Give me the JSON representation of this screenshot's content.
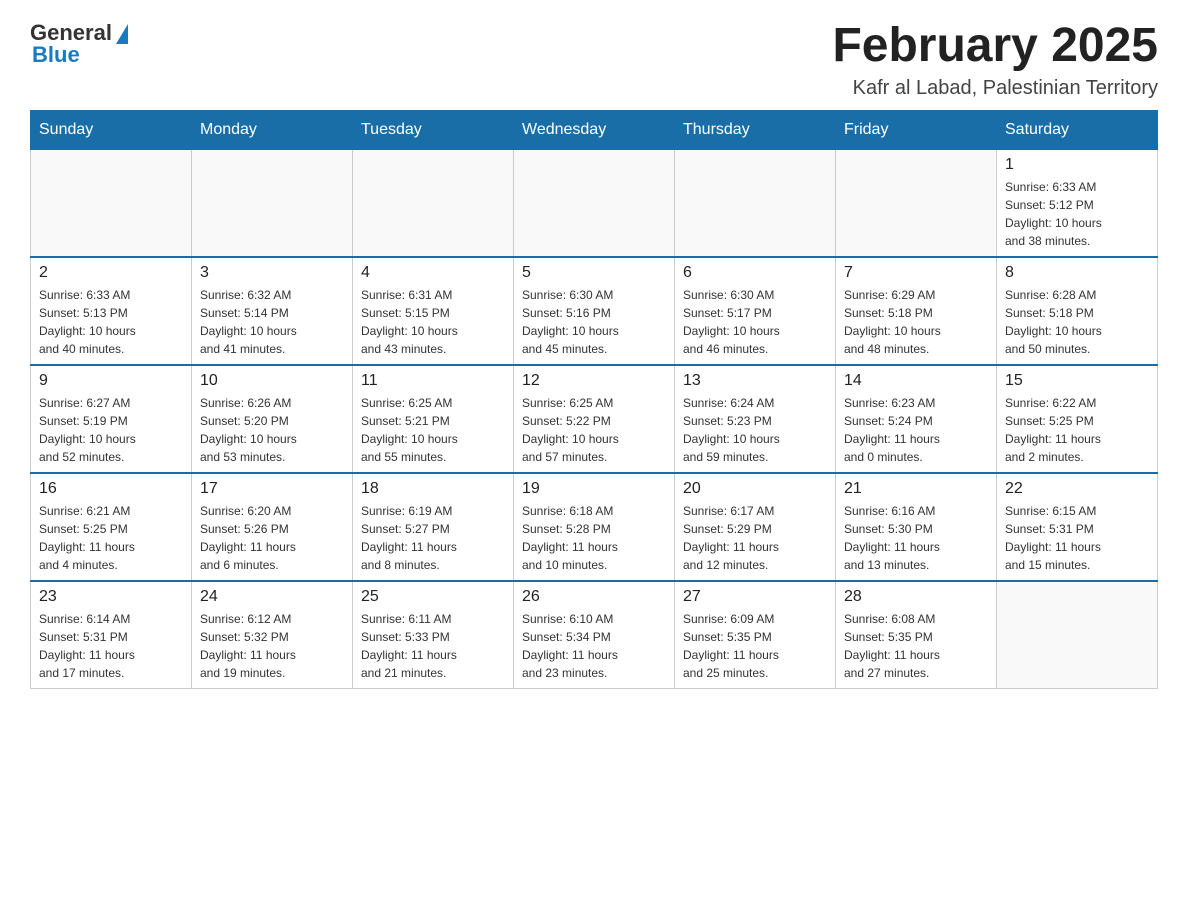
{
  "header": {
    "logo_general": "General",
    "logo_blue": "Blue",
    "title": "February 2025",
    "subtitle": "Kafr al Labad, Palestinian Territory"
  },
  "days_of_week": [
    "Sunday",
    "Monday",
    "Tuesday",
    "Wednesday",
    "Thursday",
    "Friday",
    "Saturday"
  ],
  "weeks": [
    [
      {
        "day": "",
        "info": ""
      },
      {
        "day": "",
        "info": ""
      },
      {
        "day": "",
        "info": ""
      },
      {
        "day": "",
        "info": ""
      },
      {
        "day": "",
        "info": ""
      },
      {
        "day": "",
        "info": ""
      },
      {
        "day": "1",
        "info": "Sunrise: 6:33 AM\nSunset: 5:12 PM\nDaylight: 10 hours\nand 38 minutes."
      }
    ],
    [
      {
        "day": "2",
        "info": "Sunrise: 6:33 AM\nSunset: 5:13 PM\nDaylight: 10 hours\nand 40 minutes."
      },
      {
        "day": "3",
        "info": "Sunrise: 6:32 AM\nSunset: 5:14 PM\nDaylight: 10 hours\nand 41 minutes."
      },
      {
        "day": "4",
        "info": "Sunrise: 6:31 AM\nSunset: 5:15 PM\nDaylight: 10 hours\nand 43 minutes."
      },
      {
        "day": "5",
        "info": "Sunrise: 6:30 AM\nSunset: 5:16 PM\nDaylight: 10 hours\nand 45 minutes."
      },
      {
        "day": "6",
        "info": "Sunrise: 6:30 AM\nSunset: 5:17 PM\nDaylight: 10 hours\nand 46 minutes."
      },
      {
        "day": "7",
        "info": "Sunrise: 6:29 AM\nSunset: 5:18 PM\nDaylight: 10 hours\nand 48 minutes."
      },
      {
        "day": "8",
        "info": "Sunrise: 6:28 AM\nSunset: 5:18 PM\nDaylight: 10 hours\nand 50 minutes."
      }
    ],
    [
      {
        "day": "9",
        "info": "Sunrise: 6:27 AM\nSunset: 5:19 PM\nDaylight: 10 hours\nand 52 minutes."
      },
      {
        "day": "10",
        "info": "Sunrise: 6:26 AM\nSunset: 5:20 PM\nDaylight: 10 hours\nand 53 minutes."
      },
      {
        "day": "11",
        "info": "Sunrise: 6:25 AM\nSunset: 5:21 PM\nDaylight: 10 hours\nand 55 minutes."
      },
      {
        "day": "12",
        "info": "Sunrise: 6:25 AM\nSunset: 5:22 PM\nDaylight: 10 hours\nand 57 minutes."
      },
      {
        "day": "13",
        "info": "Sunrise: 6:24 AM\nSunset: 5:23 PM\nDaylight: 10 hours\nand 59 minutes."
      },
      {
        "day": "14",
        "info": "Sunrise: 6:23 AM\nSunset: 5:24 PM\nDaylight: 11 hours\nand 0 minutes."
      },
      {
        "day": "15",
        "info": "Sunrise: 6:22 AM\nSunset: 5:25 PM\nDaylight: 11 hours\nand 2 minutes."
      }
    ],
    [
      {
        "day": "16",
        "info": "Sunrise: 6:21 AM\nSunset: 5:25 PM\nDaylight: 11 hours\nand 4 minutes."
      },
      {
        "day": "17",
        "info": "Sunrise: 6:20 AM\nSunset: 5:26 PM\nDaylight: 11 hours\nand 6 minutes."
      },
      {
        "day": "18",
        "info": "Sunrise: 6:19 AM\nSunset: 5:27 PM\nDaylight: 11 hours\nand 8 minutes."
      },
      {
        "day": "19",
        "info": "Sunrise: 6:18 AM\nSunset: 5:28 PM\nDaylight: 11 hours\nand 10 minutes."
      },
      {
        "day": "20",
        "info": "Sunrise: 6:17 AM\nSunset: 5:29 PM\nDaylight: 11 hours\nand 12 minutes."
      },
      {
        "day": "21",
        "info": "Sunrise: 6:16 AM\nSunset: 5:30 PM\nDaylight: 11 hours\nand 13 minutes."
      },
      {
        "day": "22",
        "info": "Sunrise: 6:15 AM\nSunset: 5:31 PM\nDaylight: 11 hours\nand 15 minutes."
      }
    ],
    [
      {
        "day": "23",
        "info": "Sunrise: 6:14 AM\nSunset: 5:31 PM\nDaylight: 11 hours\nand 17 minutes."
      },
      {
        "day": "24",
        "info": "Sunrise: 6:12 AM\nSunset: 5:32 PM\nDaylight: 11 hours\nand 19 minutes."
      },
      {
        "day": "25",
        "info": "Sunrise: 6:11 AM\nSunset: 5:33 PM\nDaylight: 11 hours\nand 21 minutes."
      },
      {
        "day": "26",
        "info": "Sunrise: 6:10 AM\nSunset: 5:34 PM\nDaylight: 11 hours\nand 23 minutes."
      },
      {
        "day": "27",
        "info": "Sunrise: 6:09 AM\nSunset: 5:35 PM\nDaylight: 11 hours\nand 25 minutes."
      },
      {
        "day": "28",
        "info": "Sunrise: 6:08 AM\nSunset: 5:35 PM\nDaylight: 11 hours\nand 27 minutes."
      },
      {
        "day": "",
        "info": ""
      }
    ]
  ]
}
